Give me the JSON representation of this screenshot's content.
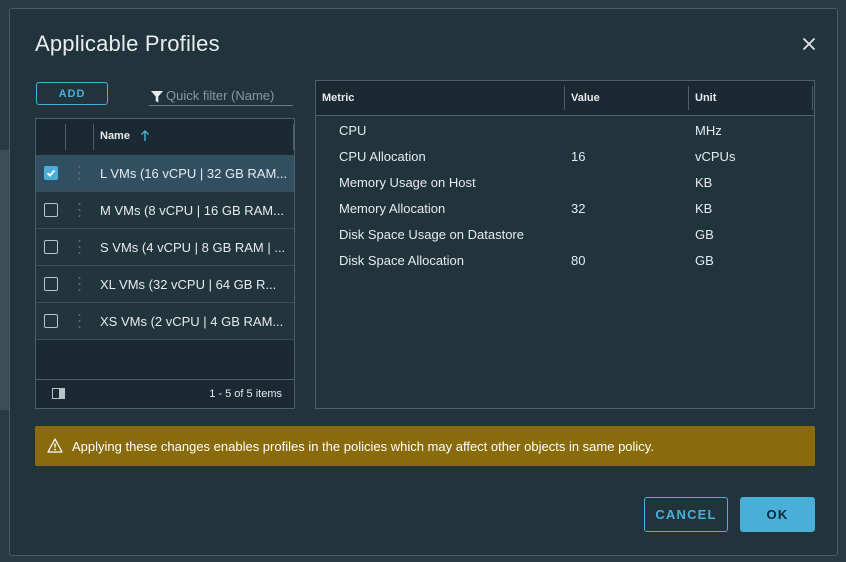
{
  "dialog": {
    "title": "Applicable Profiles"
  },
  "left_panel": {
    "add_label": "ADD",
    "filter_placeholder": "Quick filter (Name)",
    "column_name": "Name",
    "rows": [
      {
        "label": "L VMs (16 vCPU | 32 GB RAM...",
        "checked": true
      },
      {
        "label": "M VMs (8 vCPU | 16 GB RAM...",
        "checked": false
      },
      {
        "label": "S VMs (4 vCPU | 8 GB RAM | ...",
        "checked": false
      },
      {
        "label": "XL VMs (32 vCPU | 64 GB R...",
        "checked": false
      },
      {
        "label": "XS VMs (2 vCPU | 4 GB RAM...",
        "checked": false
      }
    ],
    "pagination": "1 - 5 of 5 items"
  },
  "metrics_table": {
    "headers": {
      "metric": "Metric",
      "value": "Value",
      "unit": "Unit"
    },
    "rows": [
      {
        "metric": "CPU",
        "value": "",
        "unit": "MHz"
      },
      {
        "metric": "CPU Allocation",
        "value": "16",
        "unit": "vCPUs"
      },
      {
        "metric": "Memory Usage on Host",
        "value": "",
        "unit": "KB"
      },
      {
        "metric": "Memory Allocation",
        "value": "32",
        "unit": "KB"
      },
      {
        "metric": "Disk Space Usage on Datastore",
        "value": "",
        "unit": "GB"
      },
      {
        "metric": "Disk Space Allocation",
        "value": "80",
        "unit": "GB"
      }
    ]
  },
  "warning": {
    "text": "Applying these changes enables profiles in the policies which may affect other objects in same policy."
  },
  "footer": {
    "cancel_label": "CANCEL",
    "ok_label": "OK"
  },
  "colors": {
    "accent": "#49afd9",
    "warning_bg": "#8a6b0b",
    "modal_bg": "#21333b"
  }
}
